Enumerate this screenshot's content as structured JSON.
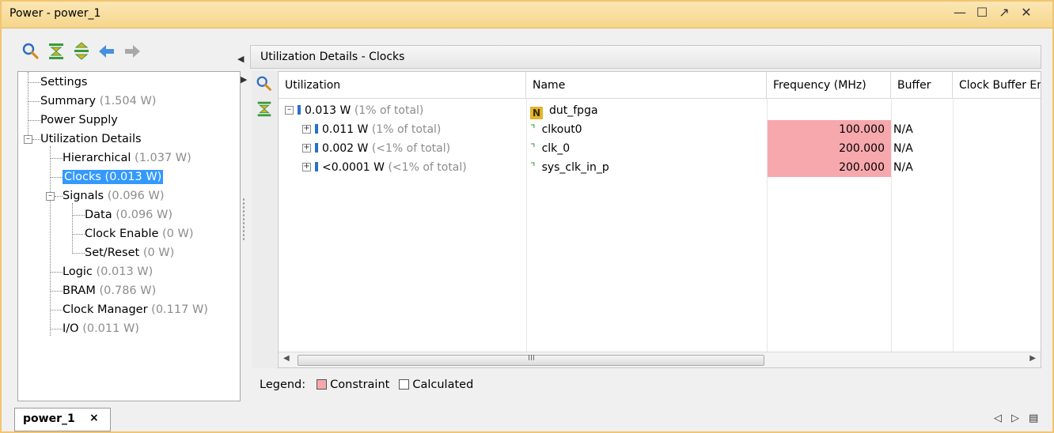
{
  "window": {
    "title": "Power - power_1",
    "controls": [
      "minimize-icon",
      "restore-icon",
      "float-icon",
      "close-icon"
    ]
  },
  "tree": {
    "items": [
      {
        "label": "Settings",
        "value": ""
      },
      {
        "label": "Summary",
        "value": "(1.504 W)"
      },
      {
        "label": "Power Supply",
        "value": ""
      },
      {
        "label": "Utilization Details",
        "value": ""
      },
      {
        "label": "Hierarchical",
        "value": "(1.037 W)"
      },
      {
        "label": "Clocks (0.013 W)",
        "value": ""
      },
      {
        "label": "Signals",
        "value": "(0.096 W)"
      },
      {
        "label": "Data",
        "value": "(0.096 W)"
      },
      {
        "label": "Clock Enable",
        "value": "(0 W)"
      },
      {
        "label": "Set/Reset",
        "value": "(0 W)"
      },
      {
        "label": "Logic",
        "value": "(0.013 W)"
      },
      {
        "label": "BRAM",
        "value": "(0.786 W)"
      },
      {
        "label": "Clock Manager",
        "value": "(0.117 W)"
      },
      {
        "label": "I/O",
        "value": "(0.011 W)"
      }
    ]
  },
  "panel": {
    "title": "Utilization Details - Clocks"
  },
  "table": {
    "columns": [
      "Utilization",
      "Name",
      "Frequency (MHz)",
      "Buffer",
      "Clock Buffer En"
    ],
    "rows": [
      {
        "power": "0.013 W",
        "pct": "(1% of total)",
        "name": "dut_fpga",
        "freq": "",
        "buffer": ""
      },
      {
        "power": "0.011 W",
        "pct": "(1% of total)",
        "name": "clkout0",
        "freq": "100.000",
        "buffer": "N/A"
      },
      {
        "power": "0.002 W",
        "pct": "(<1% of total)",
        "name": "clk_0",
        "freq": "200.000",
        "buffer": "N/A"
      },
      {
        "power": "<0.0001 W",
        "pct": "(<1% of total)",
        "name": "sys_clk_in_p",
        "freq": "200.000",
        "buffer": "N/A"
      }
    ],
    "scroll_grip": "III"
  },
  "legend": {
    "label": "Legend:",
    "constraint": "Constraint",
    "calculated": "Calculated",
    "constraint_color": "#f7a8ad"
  },
  "bottom": {
    "tab_label": "power_1",
    "tab_close": "×"
  },
  "colors": {
    "title_bar": "#f6d68c",
    "selection": "#3399ff",
    "bar_icon": "#2a6fc9"
  }
}
